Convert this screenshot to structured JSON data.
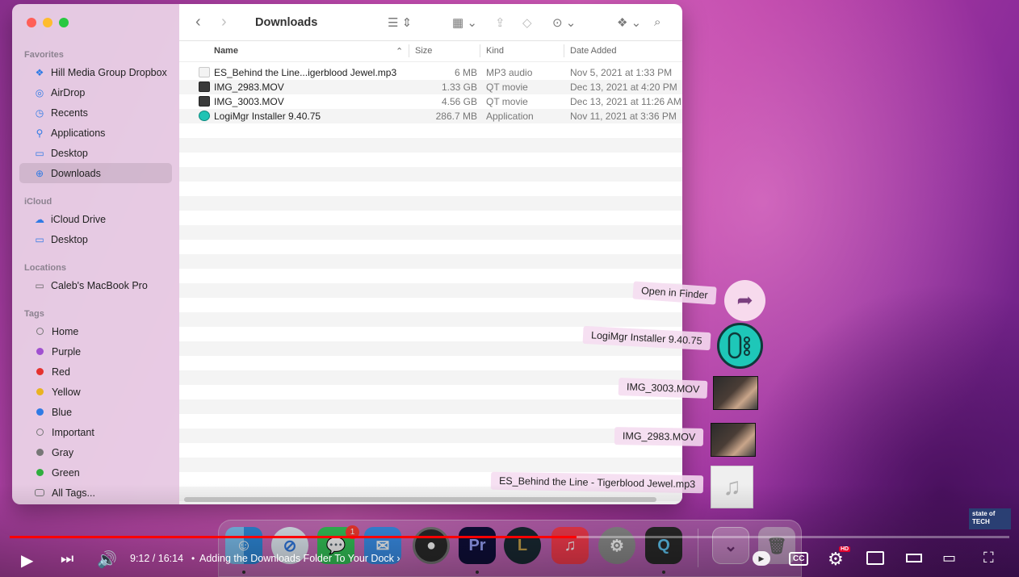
{
  "finder": {
    "title": "Downloads",
    "sidebar": {
      "favorites_header": "Favorites",
      "favorites": [
        {
          "label": "Hill Media Group Dropbox",
          "icon": "dropbox-icon"
        },
        {
          "label": "AirDrop",
          "icon": "airdrop-icon"
        },
        {
          "label": "Recents",
          "icon": "clock-icon"
        },
        {
          "label": "Applications",
          "icon": "applications-icon"
        },
        {
          "label": "Desktop",
          "icon": "desktop-icon"
        },
        {
          "label": "Downloads",
          "icon": "downloads-icon",
          "active": true
        }
      ],
      "icloud_header": "iCloud",
      "icloud": [
        {
          "label": "iCloud Drive",
          "icon": "cloud-icon"
        },
        {
          "label": "Desktop",
          "icon": "desktop-icon"
        }
      ],
      "locations_header": "Locations",
      "locations": [
        {
          "label": "Caleb's MacBook Pro",
          "icon": "laptop-icon"
        }
      ],
      "tags_header": "Tags",
      "tags": [
        {
          "label": "Home",
          "color": "none"
        },
        {
          "label": "Purple",
          "color": "#a050d0"
        },
        {
          "label": "Red",
          "color": "#e5322e"
        },
        {
          "label": "Yellow",
          "color": "#e9b321"
        },
        {
          "label": "Blue",
          "color": "#2f7ae5"
        },
        {
          "label": "Important",
          "color": "none"
        },
        {
          "label": "Gray",
          "color": "#777777"
        },
        {
          "label": "Green",
          "color": "#2fae3e"
        },
        {
          "label": "All Tags...",
          "color": "all"
        }
      ]
    },
    "columns": {
      "name": "Name",
      "size": "Size",
      "kind": "Kind",
      "date": "Date Added"
    },
    "files": [
      {
        "name": "ES_Behind the Line...igerblood Jewel.mp3",
        "size": "6 MB",
        "kind": "MP3 audio",
        "date": "Nov 5, 2021 at 1:33 PM",
        "icon": "audio"
      },
      {
        "name": "IMG_2983.MOV",
        "size": "1.33 GB",
        "kind": "QT movie",
        "date": "Dec 13, 2021 at 4:20 PM",
        "icon": "video"
      },
      {
        "name": "IMG_3003.MOV",
        "size": "4.56 GB",
        "kind": "QT movie",
        "date": "Dec 13, 2021 at 11:26 AM",
        "icon": "video"
      },
      {
        "name": "LogiMgr Installer 9.40.75",
        "size": "286.7 MB",
        "kind": "Application",
        "date": "Nov 11, 2021 at 3:36 PM",
        "icon": "app"
      }
    ]
  },
  "stack": {
    "open_in_finder": "Open in Finder",
    "items": [
      "LogiMgr Installer 9.40.75",
      "IMG_3003.MOV",
      "IMG_2983.MOV",
      "ES_Behind the Line - Tigerblood Jewel.mp3"
    ]
  },
  "dock": {
    "messages_badge": "1",
    "apps": [
      "finder-icon",
      "safari-icon",
      "messages-icon",
      "mail-icon",
      "logic-pro-icon",
      "premiere-pro-icon",
      "league-of-legends-icon",
      "music-icon",
      "system-preferences-icon",
      "quicktime-icon",
      "downloads-stack-icon",
      "trash-icon"
    ]
  },
  "player": {
    "time": "9:12 / 16:14",
    "separator": "•",
    "chapter": "Adding the Downloads Folder To Your Dock",
    "progress_fraction": 0.567,
    "hd_badge": "HD",
    "cc_label": "CC",
    "watermark": "state of TECH"
  }
}
